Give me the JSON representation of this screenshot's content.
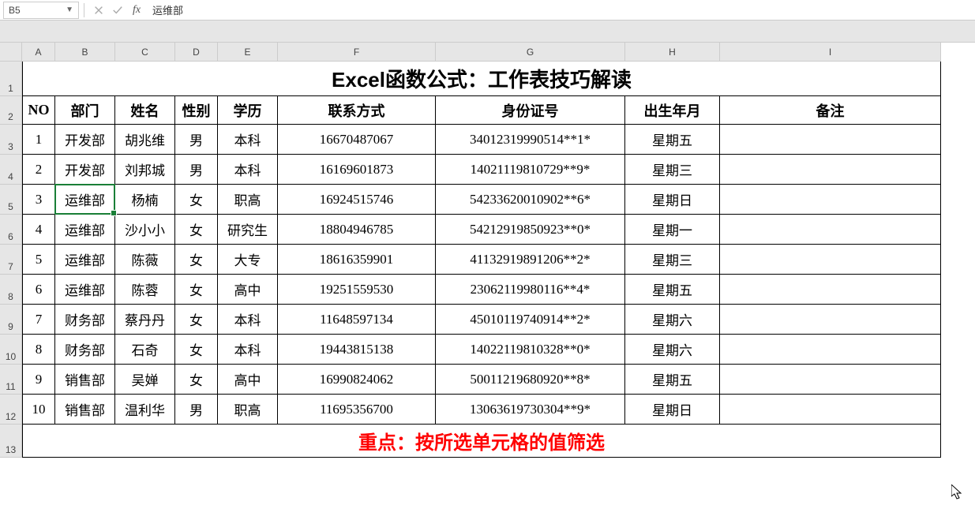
{
  "formula_bar": {
    "cell_ref": "B5",
    "value": "运维部"
  },
  "columns": [
    "A",
    "B",
    "C",
    "D",
    "E",
    "F",
    "G",
    "H",
    "I"
  ],
  "row_numbers": [
    "1",
    "2",
    "3",
    "4",
    "5",
    "6",
    "7",
    "8",
    "9",
    "10",
    "11",
    "12",
    "13"
  ],
  "title": "Excel函数公式：工作表技巧解读",
  "headers": [
    "NO",
    "部门",
    "姓名",
    "性别",
    "学历",
    "联系方式",
    "身份证号",
    "出生年月",
    "备注"
  ],
  "rows": [
    {
      "no": "1",
      "dept": "开发部",
      "name": "胡兆维",
      "gender": "男",
      "edu": "本科",
      "phone": "16670487067",
      "id": "34012319990514**1*",
      "dob": "星期五",
      "note": ""
    },
    {
      "no": "2",
      "dept": "开发部",
      "name": "刘邦城",
      "gender": "男",
      "edu": "本科",
      "phone": "16169601873",
      "id": "14021119810729**9*",
      "dob": "星期三",
      "note": ""
    },
    {
      "no": "3",
      "dept": "运维部",
      "name": "杨楠",
      "gender": "女",
      "edu": "职高",
      "phone": "16924515746",
      "id": "54233620010902**6*",
      "dob": "星期日",
      "note": ""
    },
    {
      "no": "4",
      "dept": "运维部",
      "name": "沙小小",
      "gender": "女",
      "edu": "研究生",
      "phone": "18804946785",
      "id": "54212919850923**0*",
      "dob": "星期一",
      "note": ""
    },
    {
      "no": "5",
      "dept": "运维部",
      "name": "陈薇",
      "gender": "女",
      "edu": "大专",
      "phone": "18616359901",
      "id": "41132919891206**2*",
      "dob": "星期三",
      "note": ""
    },
    {
      "no": "6",
      "dept": "运维部",
      "name": "陈蓉",
      "gender": "女",
      "edu": "高中",
      "phone": "19251559530",
      "id": "23062119980116**4*",
      "dob": "星期五",
      "note": ""
    },
    {
      "no": "7",
      "dept": "财务部",
      "name": "蔡丹丹",
      "gender": "女",
      "edu": "本科",
      "phone": "11648597134",
      "id": "45010119740914**2*",
      "dob": "星期六",
      "note": ""
    },
    {
      "no": "8",
      "dept": "财务部",
      "name": "石奇",
      "gender": "女",
      "edu": "本科",
      "phone": "19443815138",
      "id": "14022119810328**0*",
      "dob": "星期六",
      "note": ""
    },
    {
      "no": "9",
      "dept": "销售部",
      "name": "吴婵",
      "gender": "女",
      "edu": "高中",
      "phone": "16990824062",
      "id": "50011219680920**8*",
      "dob": "星期五",
      "note": ""
    },
    {
      "no": "10",
      "dept": "销售部",
      "name": "温利华",
      "gender": "男",
      "edu": "职高",
      "phone": "11695356700",
      "id": "13063619730304**9*",
      "dob": "星期日",
      "note": ""
    }
  ],
  "footer": "重点：按所选单元格的值筛选"
}
